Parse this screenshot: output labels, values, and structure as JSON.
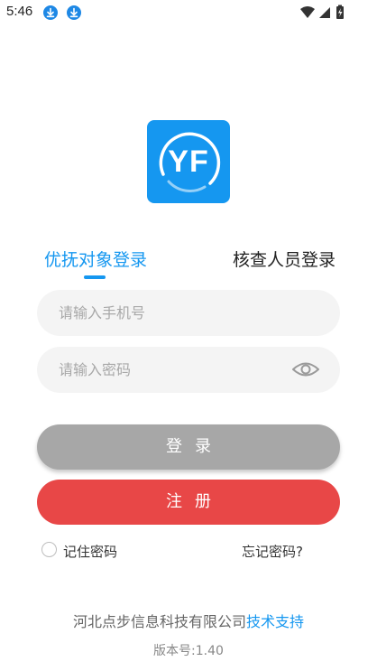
{
  "status_bar": {
    "time": "5:46",
    "icons": [
      "download-icon",
      "download-icon",
      "wifi-icon",
      "signal-icon",
      "battery-icon"
    ]
  },
  "logo": {
    "text": "YF",
    "color": "#1597f0"
  },
  "tabs": [
    {
      "label": "优抚对象登录",
      "active": true
    },
    {
      "label": "核查人员登录",
      "active": false
    }
  ],
  "form": {
    "phone_placeholder": "请输入手机号",
    "password_placeholder": "请输入密码",
    "phone_value": "",
    "password_value": ""
  },
  "buttons": {
    "login_label": "登录",
    "register_label": "注册",
    "login_color": "#a7a7a7",
    "register_color": "#e84747"
  },
  "options": {
    "remember_label": "记住密码",
    "remember_checked": false,
    "forgot_label": "忘记密码?"
  },
  "footer": {
    "company": "河北点步信息科技有限公司",
    "support": "技术支持",
    "version": "版本号:1.40"
  }
}
